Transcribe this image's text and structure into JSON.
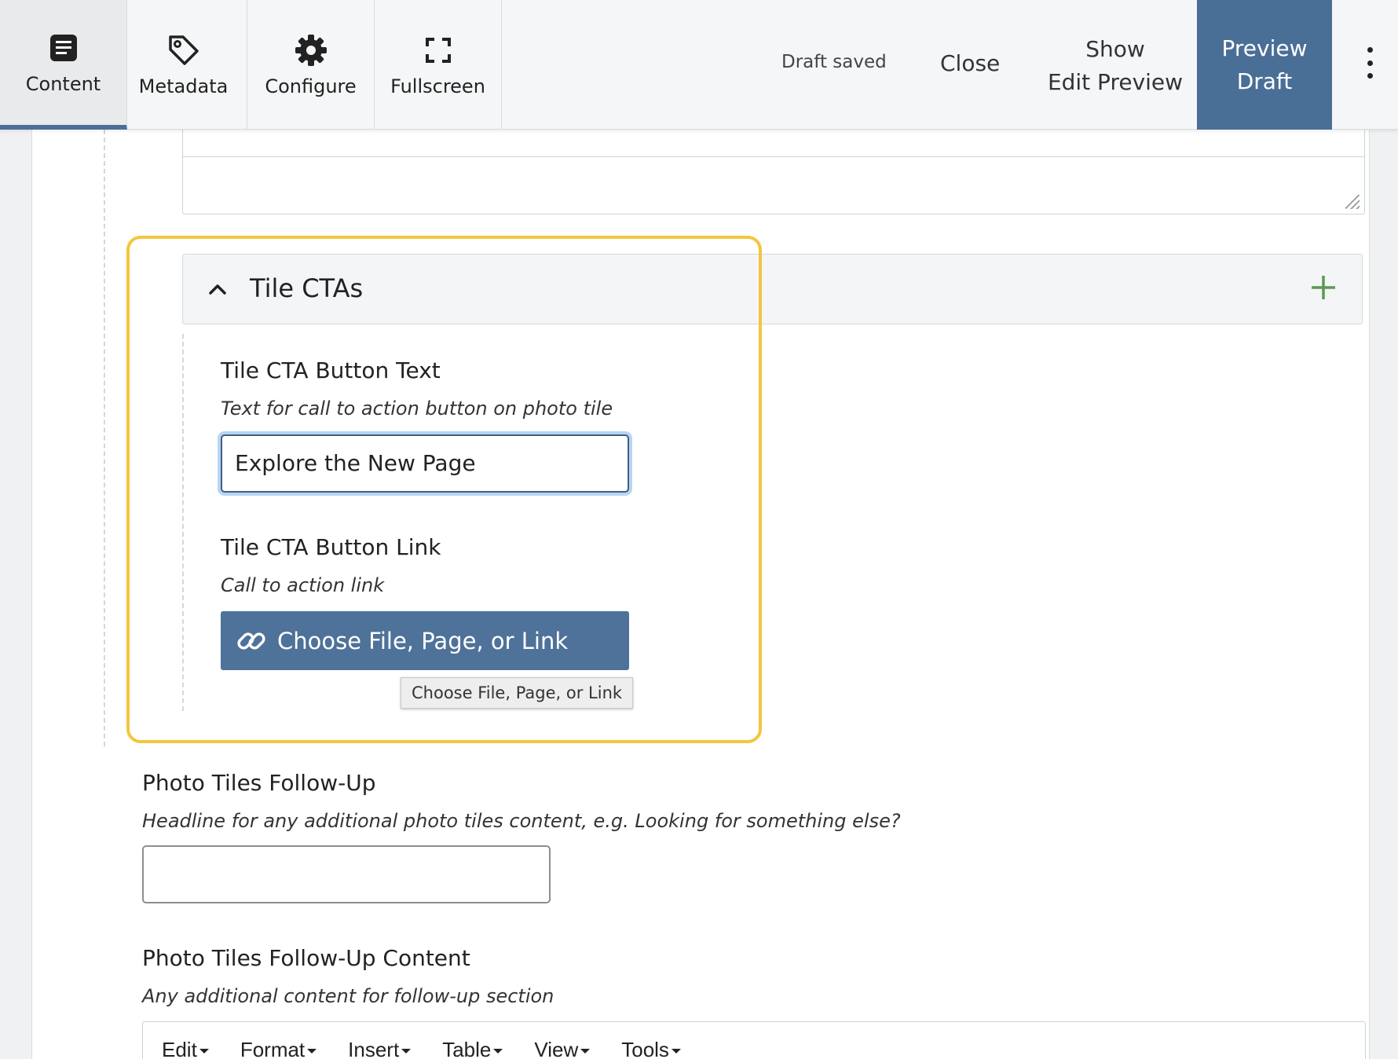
{
  "toolbar": {
    "tabs": [
      {
        "label": "Content",
        "icon": "document-icon",
        "active": true
      },
      {
        "label": "Metadata",
        "icon": "tag-icon",
        "active": false
      },
      {
        "label": "Configure",
        "icon": "gear-icon",
        "active": false
      },
      {
        "label": "Fullscreen",
        "icon": "fullscreen-icon",
        "active": false
      }
    ],
    "status": "Draft saved",
    "close_label": "Close",
    "show_edit_preview_line1": "Show",
    "show_edit_preview_line2": "Edit Preview",
    "preview_draft_line1": "Preview",
    "preview_draft_line2": "Draft",
    "more_icon": "kebab-icon"
  },
  "tile_ctas": {
    "title": "Tile CTAs",
    "expanded": true,
    "button_text": {
      "label": "Tile CTA Button Text",
      "help": "Text for call to action button on photo tile",
      "value": "Explore the New Page"
    },
    "button_link": {
      "label": "Tile CTA Button Link",
      "help": "Call to action link",
      "button_label": "Choose File, Page, or Link",
      "tooltip": "Choose File, Page, or Link"
    }
  },
  "followup": {
    "label": "Photo Tiles Follow-Up",
    "help": "Headline for any additional photo tiles content, e.g. Looking for something else?",
    "value": ""
  },
  "followup_content": {
    "label": "Photo Tiles Follow-Up Content",
    "help": "Any additional content for follow-up section",
    "menu": [
      "Edit",
      "Format",
      "Insert",
      "Table",
      "View",
      "Tools"
    ]
  },
  "colors": {
    "accent": "#4a6f96",
    "highlight": "#f3c63f",
    "add": "#5a9a55"
  }
}
